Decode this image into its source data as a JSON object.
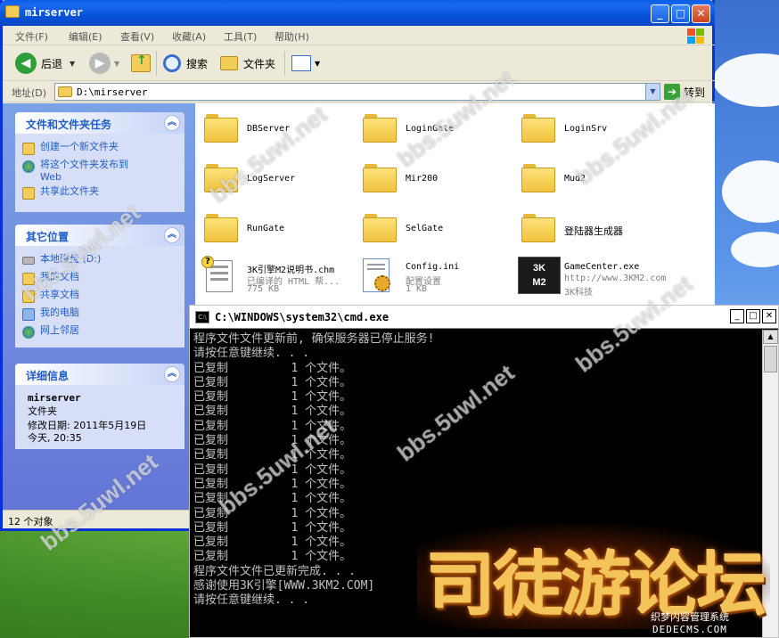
{
  "explorer": {
    "title": "mirserver",
    "menu": [
      "文件(F)",
      "编辑(E)",
      "查看(V)",
      "收藏(A)",
      "工具(T)",
      "帮助(H)"
    ],
    "toolbar": {
      "back_label": "后退",
      "search_label": "搜索",
      "folders_label": "文件夹"
    },
    "address": {
      "label": "地址(D)",
      "value": "D:\\mirserver",
      "go_label": "转到"
    },
    "tasks": {
      "file_folder_tasks": {
        "header": "文件和文件夹任务",
        "items": [
          "创建一个新文件夹",
          "将这个文件夹发布到\nWeb",
          "共享此文件夹"
        ]
      },
      "other_places": {
        "header": "其它位置",
        "items": [
          "本地磁盘 (D:)",
          "我的文档",
          "共享文档",
          "我的电脑",
          "网上邻居"
        ]
      },
      "details": {
        "header": "详细信息",
        "name": "mirserver",
        "type": "文件夹",
        "modified_label": "修改日期: 2011年5月19日",
        "modified_time": "今天, 20:35"
      }
    },
    "files": [
      {
        "name": "DBServer",
        "kind": "folder"
      },
      {
        "name": "LoginGate",
        "kind": "folder"
      },
      {
        "name": "LoginSrv",
        "kind": "folder"
      },
      {
        "name": "LogServer",
        "kind": "folder"
      },
      {
        "name": "Mir200",
        "kind": "folder"
      },
      {
        "name": "Mud2",
        "kind": "folder"
      },
      {
        "name": "RunGate",
        "kind": "folder"
      },
      {
        "name": "SelGate",
        "kind": "folder"
      },
      {
        "name": "登陆器生成器",
        "kind": "folder"
      },
      {
        "name": "3K引擎M2说明书.chm",
        "kind": "chm",
        "sub1": "已编译的 HTML 帮...",
        "sub2": "775 KB"
      },
      {
        "name": "Config.ini",
        "kind": "ini",
        "sub1": "配置设置",
        "sub2": "1 KB"
      },
      {
        "name": "GameCenter.exe",
        "kind": "exe",
        "sub1": "http://www.3KM2.com",
        "sub2": "3K科技"
      }
    ],
    "status": "12 个对象"
  },
  "cmd": {
    "title": "C:\\WINDOWS\\system32\\cmd.exe",
    "icon_text": "C:\\",
    "lines": [
      "程序文件文件更新前, 确保服务器已停止服务!",
      "请按任意键继续. . .",
      "已复制         1 个文件。",
      "已复制         1 个文件。",
      "已复制         1 个文件。",
      "已复制         1 个文件。",
      "已复制         1 个文件。",
      "已复制         1 个文件。",
      "已复制         1 个文件。",
      "已复制         1 个文件。",
      "已复制         1 个文件。",
      "已复制         1 个文件。",
      "已复制         1 个文件。",
      "已复制         1 个文件。",
      "已复制         1 个文件。",
      "已复制         1 个文件。",
      "程序文件文件已更新完成. . .",
      "感谢使用3K引擎[WWW.3KM2.COM]",
      "请按任意键继续. . ."
    ]
  },
  "overlay": {
    "forum_logo_text": "司徒游论坛",
    "site_tag": "织梦内容管理系统",
    "dede_tag": "DEDECMS.COM",
    "watermark": "bbs.5uwl.net"
  },
  "colors": {
    "xp_blue": "#0831d9",
    "task_link": "#215dc6",
    "console_text": "#c0c0c0"
  }
}
